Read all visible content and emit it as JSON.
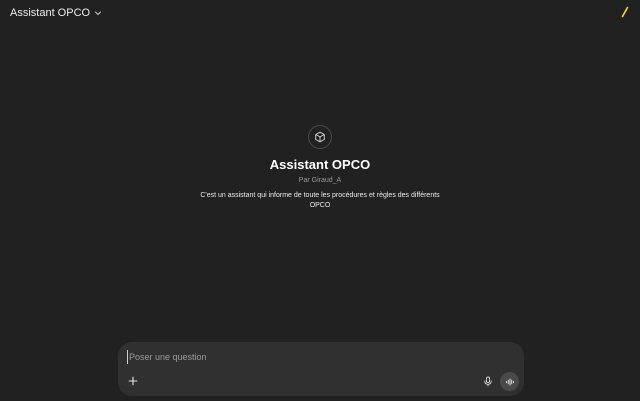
{
  "header": {
    "model_title": "Assistant OPCO",
    "icons": {
      "dropdown": "chevron-down-icon",
      "new_chat": "pencil-icon"
    },
    "accent_color": "#f5d547"
  },
  "gpt": {
    "name": "Assistant OPCO",
    "author": "Par Giraud_A",
    "description": "C'est un assistant qui informe de toute les procédures et règles des différents OPCO",
    "avatar_icon": "cube-icon"
  },
  "composer": {
    "placeholder": "Poser une question",
    "value": "",
    "icons": {
      "attach": "plus-icon",
      "mic": "microphone-icon",
      "voice": "voice-mode-icon"
    }
  }
}
